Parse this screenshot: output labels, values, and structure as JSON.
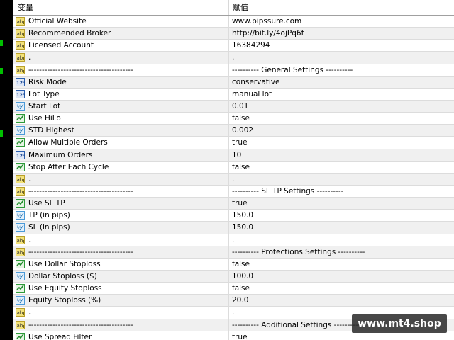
{
  "header": {
    "col_variable": "变量",
    "col_value": "赋值"
  },
  "rows": [
    {
      "type": "ab",
      "name": "Official Website",
      "value": "www.pipssure.com"
    },
    {
      "type": "ab",
      "name": "Recommended Broker",
      "value": "http://bit.ly/4ojPq6f"
    },
    {
      "type": "ab",
      "name": "Licensed Account",
      "value": "16384294"
    },
    {
      "type": "ab",
      "name": ".",
      "value": "."
    },
    {
      "type": "ab",
      "name": "---------------------------------------",
      "value": "---------- General Settings ----------"
    },
    {
      "type": "123",
      "name": "Risk Mode",
      "value": "conservative"
    },
    {
      "type": "123",
      "name": "Lot Type",
      "value": "manual lot"
    },
    {
      "type": "half",
      "name": "Start Lot",
      "value": "0.01"
    },
    {
      "type": "bool",
      "name": "Use HiLo",
      "value": "false"
    },
    {
      "type": "half",
      "name": "STD Highest",
      "value": "0.002"
    },
    {
      "type": "bool",
      "name": "Allow Multiple Orders",
      "value": "true"
    },
    {
      "type": "123",
      "name": "Maximum Orders",
      "value": "10"
    },
    {
      "type": "bool",
      "name": "Stop After Each Cycle",
      "value": "false"
    },
    {
      "type": "ab",
      "name": ".",
      "value": "."
    },
    {
      "type": "ab",
      "name": "---------------------------------------",
      "value": "---------- SL TP Settings ----------"
    },
    {
      "type": "bool",
      "name": "Use SL TP",
      "value": "true"
    },
    {
      "type": "half",
      "name": "TP (in pips)",
      "value": "150.0"
    },
    {
      "type": "half",
      "name": "SL (in pips)",
      "value": "150.0"
    },
    {
      "type": "ab",
      "name": ".",
      "value": "."
    },
    {
      "type": "ab",
      "name": "---------------------------------------",
      "value": "---------- Protections Settings ----------"
    },
    {
      "type": "bool",
      "name": "Use Dollar Stoploss",
      "value": "false"
    },
    {
      "type": "half",
      "name": "Dollar Stoploss ($)",
      "value": "100.0"
    },
    {
      "type": "bool",
      "name": "Use Equity Stoploss",
      "value": "false"
    },
    {
      "type": "half",
      "name": "Equity Stoploss (%)",
      "value": "20.0"
    },
    {
      "type": "ab",
      "name": ".",
      "value": "."
    },
    {
      "type": "ab",
      "name": "---------------------------------------",
      "value": "---------- Additional Settings ----------"
    },
    {
      "type": "bool",
      "name": "Use Spread Filter",
      "value": "true"
    }
  ],
  "watermark": "www.mt4.shop",
  "colors": {
    "row_alt": "#f0f0f0",
    "grid": "#dcdcdc",
    "icon_ab": "#e8d24a",
    "icon_num": "#2a5fb0",
    "icon_half": "#4a9ad8",
    "icon_bool": "#2e9a3a"
  }
}
